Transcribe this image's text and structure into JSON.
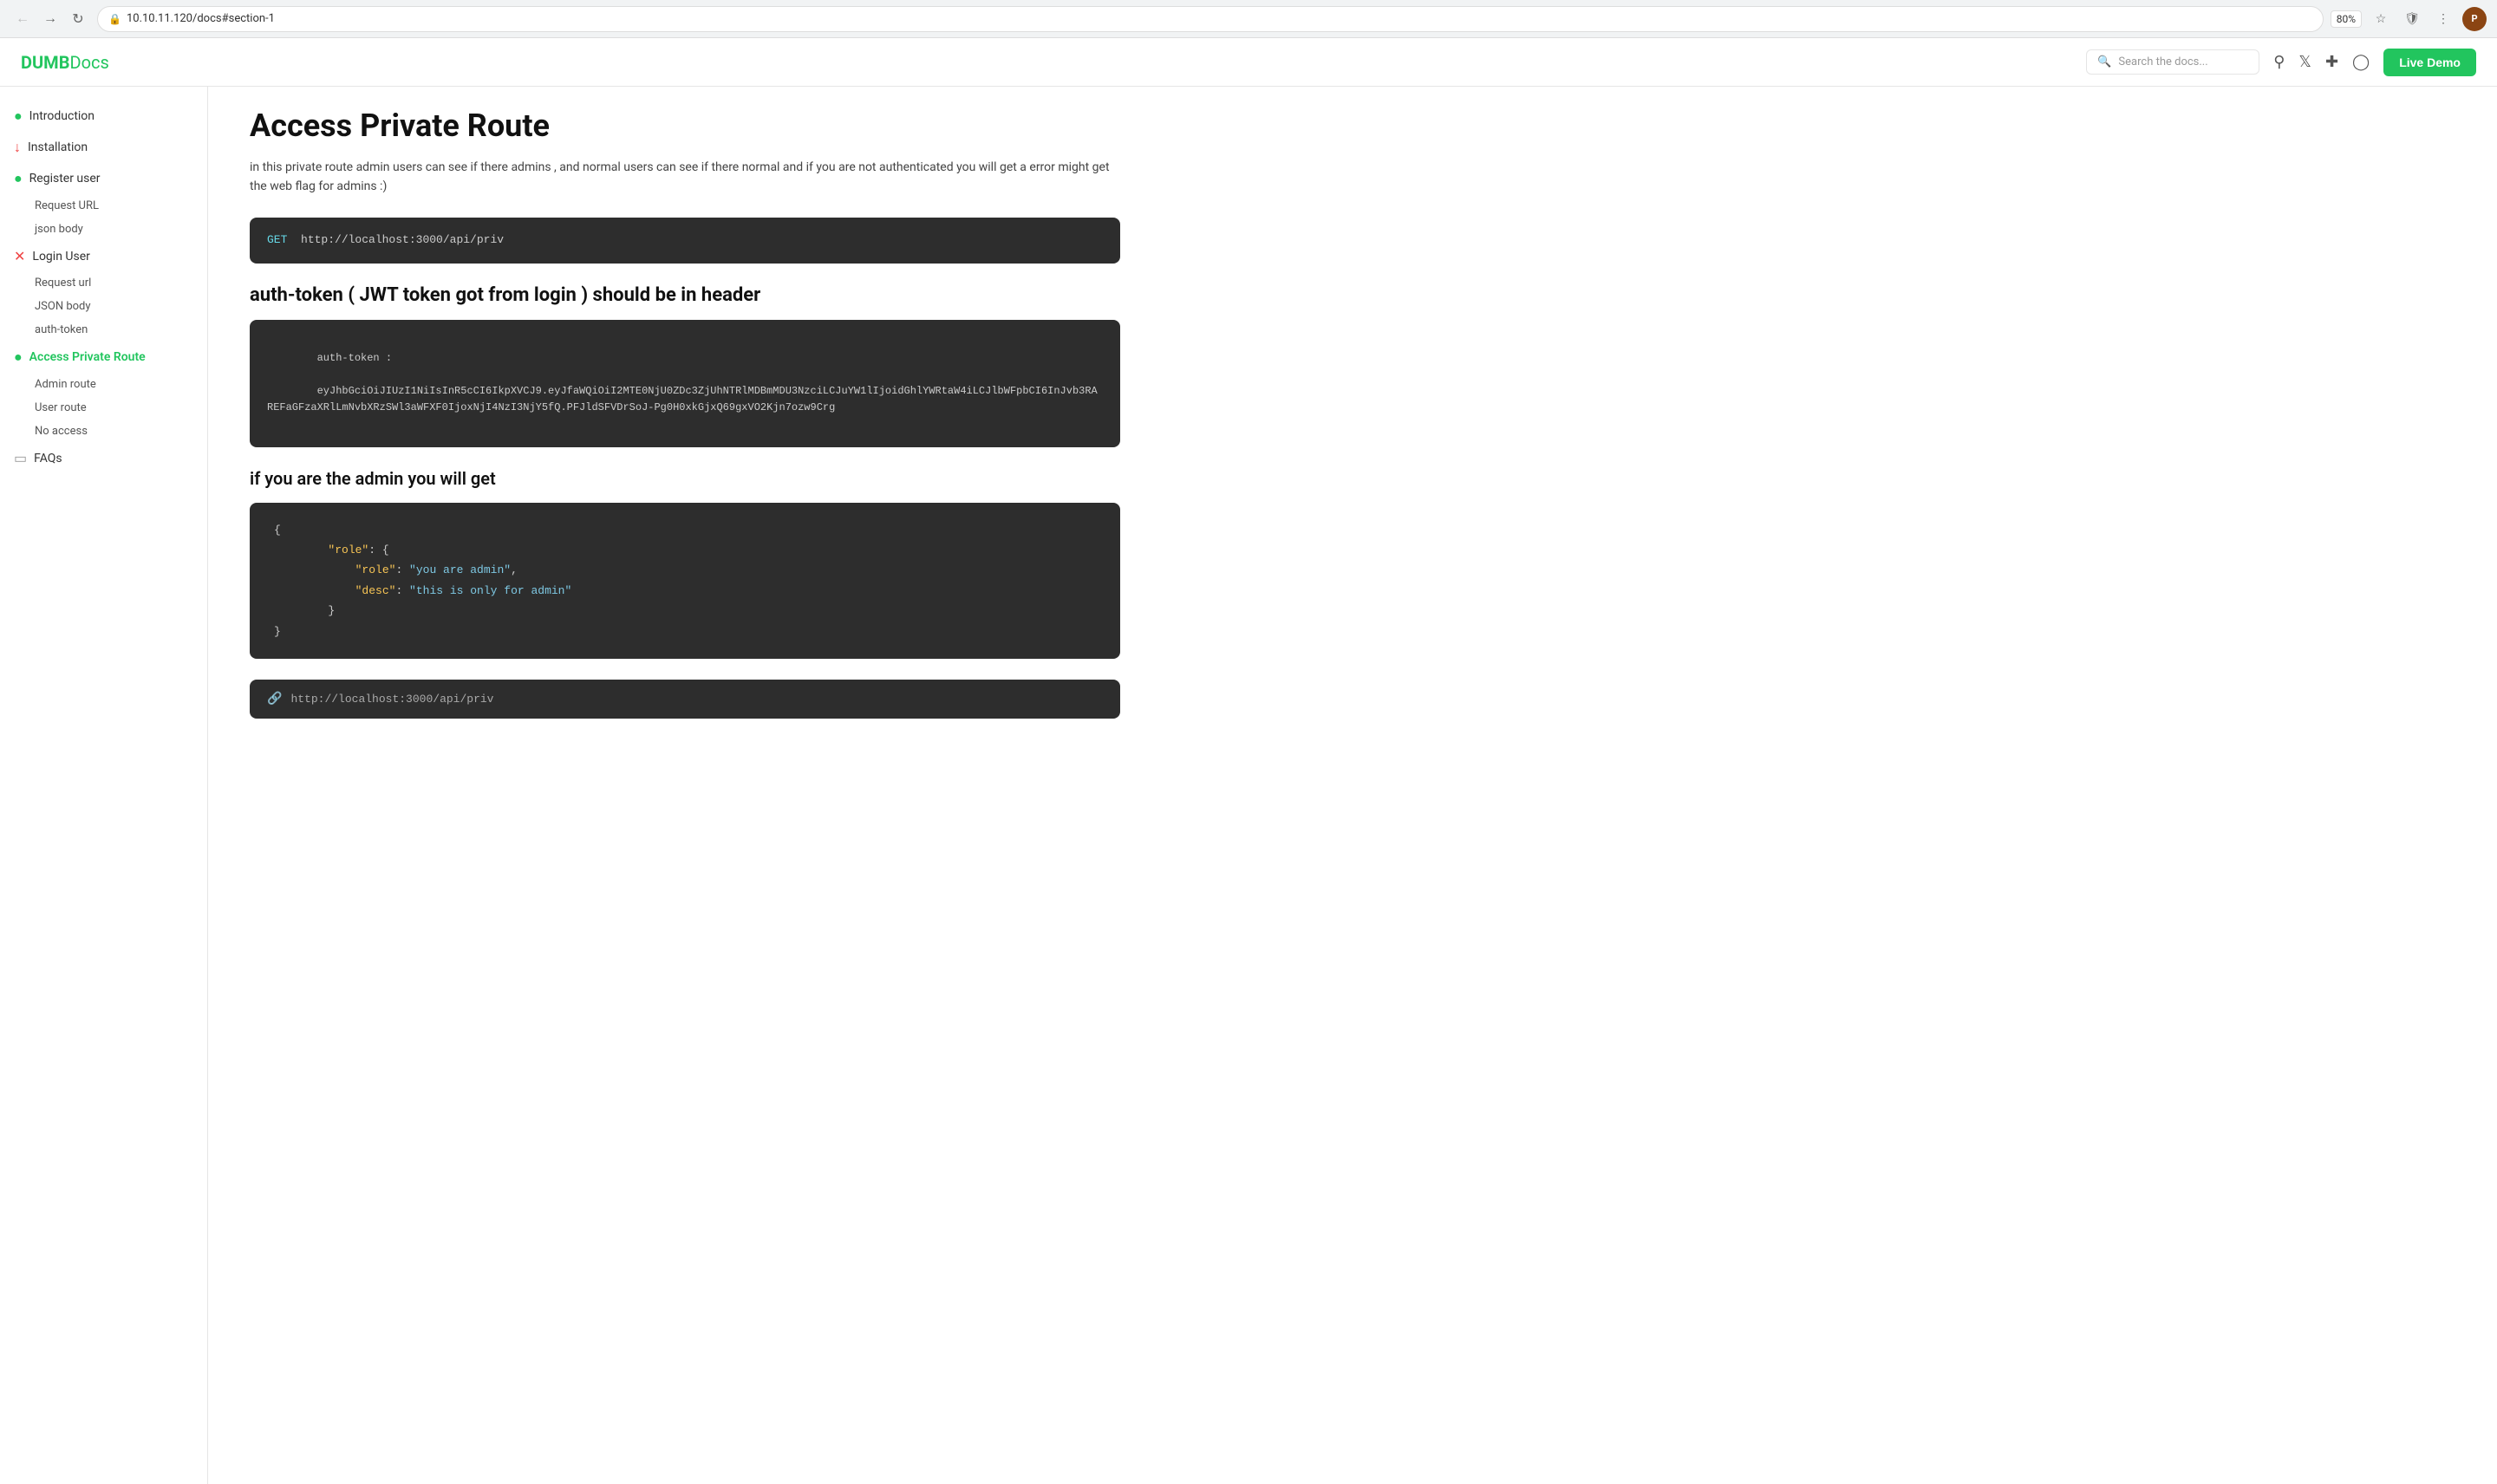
{
  "browser": {
    "url": "10.10.11.120/docs#section-1",
    "zoom": "80%"
  },
  "topnav": {
    "logo_bold": "DUMB",
    "logo_light": "Docs",
    "search_placeholder": "Search the docs...",
    "live_demo_label": "Live Demo"
  },
  "sidebar": {
    "items": [
      {
        "id": "introduction",
        "label": "Introduction",
        "icon": "●",
        "icon_color": "green",
        "active": false
      },
      {
        "id": "installation",
        "label": "Installation",
        "icon": "↓",
        "icon_color": "red",
        "active": false
      },
      {
        "id": "register-user",
        "label": "Register user",
        "icon": "●",
        "icon_color": "green",
        "active": false
      },
      {
        "id": "login-user",
        "label": "Login User",
        "icon": "✕",
        "icon_color": "red",
        "active": false
      },
      {
        "id": "access-private-route",
        "label": "Access Private Route",
        "icon": "●",
        "icon_color": "green",
        "active": true
      }
    ],
    "register_subitems": [
      {
        "id": "request-url",
        "label": "Request URL"
      },
      {
        "id": "json-body",
        "label": "json body"
      }
    ],
    "login_subitems": [
      {
        "id": "request-url-login",
        "label": "Request url"
      },
      {
        "id": "json-body-login",
        "label": "JSON body"
      },
      {
        "id": "auth-token",
        "label": "auth-token"
      }
    ],
    "access_subitems": [
      {
        "id": "admin-route",
        "label": "Admin route"
      },
      {
        "id": "user-route",
        "label": "User route"
      },
      {
        "id": "no-access",
        "label": "No access"
      }
    ],
    "faqs": {
      "label": "FAQs",
      "icon": "▭",
      "icon_color": "gray"
    }
  },
  "content": {
    "page_title": "Access Private Route",
    "description": "in this private route admin users can see if there admins , and normal users can see if there normal and if you are not authenticated you will get a error might get the web flag for admins :)",
    "endpoint_method": "GET",
    "endpoint_url": "http://localhost:3000/api/priv",
    "auth_token_heading": "auth-token ( JWT token got from login ) should be in header",
    "auth_token_label": "auth-token :",
    "auth_token_value": "eyJhbGciOiJIUzI1NiIsInR5cCI6IkpXVCJ9.eyJfaWQiOiI2MTE0NjU0ZDc3ZjUhNTRlMDBmMDU3NzciLCJuYW1lIjoidGhlYWRtaW4iLCJlbWFpbCI6InJvb3RAREFaGFzaXRlLmNvbXRzSWl3aWFXF0IjoxNjI4NzI3NjY5fQ.PFJldSFVDrSoJ-Pg0H0xkGjxQ69gxVO2Kjn7ozw9Crg",
    "admin_section_heading": "if you are the admin you will get",
    "admin_json": {
      "role": {
        "role": "you are admin",
        "desc": "this is only for admin"
      }
    },
    "bottom_url": "http://localhost:3000/api/priv"
  }
}
